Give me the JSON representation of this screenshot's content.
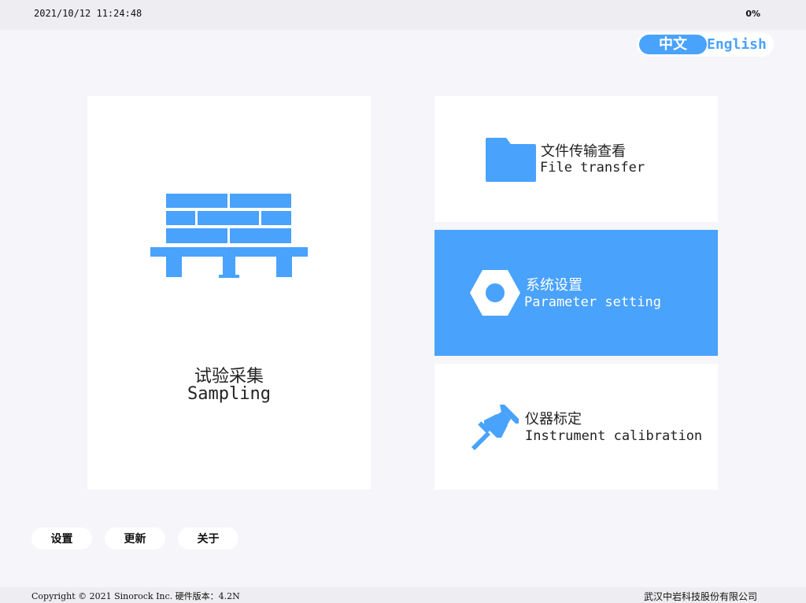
{
  "status_bar": {
    "datetime": "2021/10/12 11:24:48",
    "battery": "0%"
  },
  "language": {
    "zh_label": "中文",
    "en_label": "English",
    "selected": "中文"
  },
  "tiles": {
    "sampling": {
      "zh": "试验采集",
      "en": "Sampling",
      "icon": "pallet-bricks-icon"
    },
    "file_transfer": {
      "zh": "文件传输查看",
      "en": "File transfer",
      "icon": "folder-icon"
    },
    "parameter_setting": {
      "zh": "系统设置",
      "en": "Parameter setting",
      "icon": "hex-nut-icon",
      "active": true
    },
    "instrument_calibration": {
      "zh": "仪器标定",
      "en": "Instrument calibration",
      "icon": "pushpin-icon"
    }
  },
  "bottom_buttons": {
    "settings": "设置",
    "update": "更新",
    "about": "关于"
  },
  "footer": {
    "copyright": "Copyright © 2021 Sinorock Inc. 硬件版本：4.2N",
    "company": "武汉中岩科技股份有限公司"
  },
  "colors": {
    "accent": "#49a2fb",
    "background": "#f5f5fa",
    "card": "#ffffff"
  }
}
